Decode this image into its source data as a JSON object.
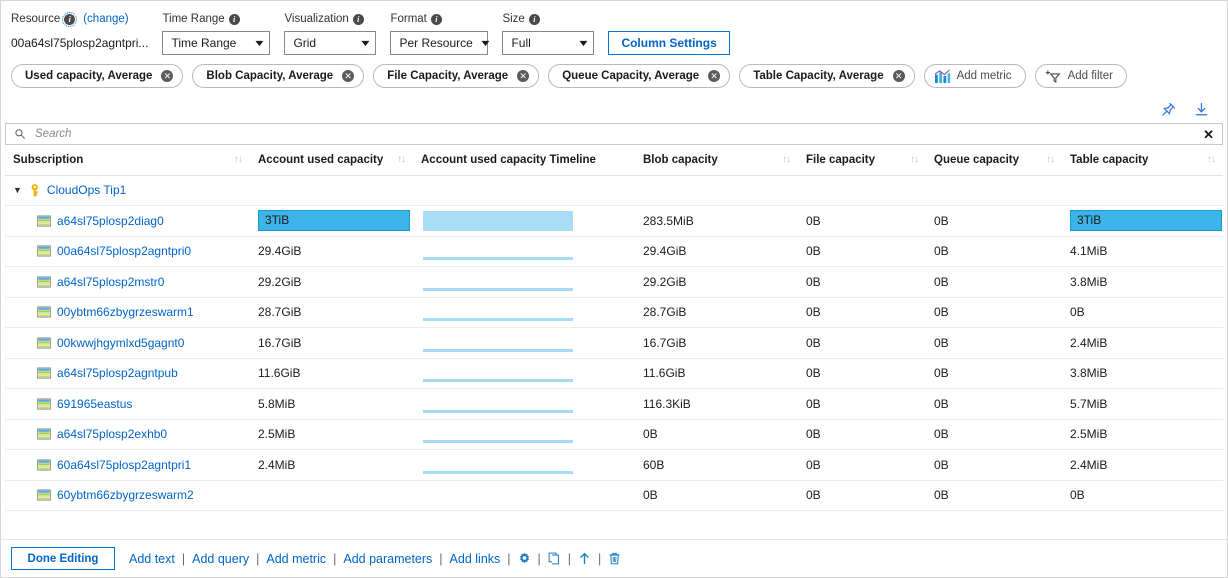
{
  "params": {
    "resource": {
      "label": "Resource",
      "info_icon": "info-icon",
      "change_link": "(change)",
      "value": "00a64sl75plosp2agntpri..."
    },
    "time_range": {
      "label": "Time Range",
      "value": "Time Range"
    },
    "visualization": {
      "label": "Visualization",
      "value": "Grid"
    },
    "format": {
      "label": "Format",
      "value": "Per Resource"
    },
    "size": {
      "label": "Size",
      "value": "Full"
    },
    "column_settings_button": "Column Settings"
  },
  "metric_pills": [
    {
      "label": "Used capacity, Average",
      "remove": "✕"
    },
    {
      "label": "Blob Capacity, Average",
      "remove": "✕"
    },
    {
      "label": "File Capacity, Average",
      "remove": "✕"
    },
    {
      "label": "Queue Capacity, Average",
      "remove": "✕"
    },
    {
      "label": "Table Capacity, Average",
      "remove": "✕"
    }
  ],
  "pill_actions": [
    {
      "label": "Add metric",
      "icon": "bar-chart-icon"
    },
    {
      "label": "Add filter",
      "icon": "funnel-plus-icon"
    }
  ],
  "toolbar_icons": [
    {
      "name": "pin-icon"
    },
    {
      "name": "download-icon"
    }
  ],
  "search": {
    "placeholder": "Search",
    "value": "",
    "icon": "search-icon",
    "clear": "✕"
  },
  "grid": {
    "columns": [
      {
        "label": "Subscription",
        "sortable": true
      },
      {
        "label": "Account used capacity",
        "sortable": true
      },
      {
        "label": "Account used capacity Timeline",
        "sortable": false
      },
      {
        "label": "Blob capacity",
        "sortable": true
      },
      {
        "label": "File capacity",
        "sortable": true
      },
      {
        "label": "Queue capacity",
        "sortable": true
      },
      {
        "label": "Table capacity",
        "sortable": true
      }
    ],
    "sort_glyph": "↑↓",
    "group": {
      "name": "CloudOps Tip1",
      "caret": "▼",
      "icon": "key-icon",
      "expanded": true
    },
    "rows": [
      {
        "name": "a64sl75plosp2diag0",
        "used_capacity": "3TiB",
        "used_capacity_highlighted": true,
        "timeline": "block",
        "blob": "283.5MiB",
        "file": "0B",
        "queue": "0B",
        "table": "3TiB",
        "table_highlighted": true
      },
      {
        "name": "00a64sl75plosp2agntpri0",
        "used_capacity": "29.4GiB",
        "used_capacity_highlighted": false,
        "timeline": "flat",
        "blob": "29.4GiB",
        "file": "0B",
        "queue": "0B",
        "table": "4.1MiB",
        "table_highlighted": false
      },
      {
        "name": "a64sl75plosp2mstr0",
        "used_capacity": "29.2GiB",
        "used_capacity_highlighted": false,
        "timeline": "flat",
        "blob": "29.2GiB",
        "file": "0B",
        "queue": "0B",
        "table": "3.8MiB",
        "table_highlighted": false
      },
      {
        "name": "00ybtm66zbygrzeswarm1",
        "used_capacity": "28.7GiB",
        "used_capacity_highlighted": false,
        "timeline": "flat",
        "blob": "28.7GiB",
        "file": "0B",
        "queue": "0B",
        "table": "0B",
        "table_highlighted": false
      },
      {
        "name": "00kwwjhgymlxd5gagnt0",
        "used_capacity": "16.7GiB",
        "used_capacity_highlighted": false,
        "timeline": "flat",
        "blob": "16.7GiB",
        "file": "0B",
        "queue": "0B",
        "table": "2.4MiB",
        "table_highlighted": false
      },
      {
        "name": "a64sl75plosp2agntpub",
        "used_capacity": "11.6GiB",
        "used_capacity_highlighted": false,
        "timeline": "flat",
        "blob": "11.6GiB",
        "file": "0B",
        "queue": "0B",
        "table": "3.8MiB",
        "table_highlighted": false
      },
      {
        "name": "691965eastus",
        "used_capacity": "5.8MiB",
        "used_capacity_highlighted": false,
        "timeline": "flat",
        "blob": "116.3KiB",
        "file": "0B",
        "queue": "0B",
        "table": "5.7MiB",
        "table_highlighted": false
      },
      {
        "name": "a64sl75plosp2exhb0",
        "used_capacity": "2.5MiB",
        "used_capacity_highlighted": false,
        "timeline": "flat",
        "blob": "0B",
        "file": "0B",
        "queue": "0B",
        "table": "2.5MiB",
        "table_highlighted": false
      },
      {
        "name": "60a64sl75plosp2agntpri1",
        "used_capacity": "2.4MiB",
        "used_capacity_highlighted": false,
        "timeline": "flat",
        "blob": "60B",
        "file": "0B",
        "queue": "0B",
        "table": "2.4MiB",
        "table_highlighted": false
      },
      {
        "name": "60ybtm66zbygrzeswarm2",
        "used_capacity": "",
        "used_capacity_highlighted": false,
        "timeline": "none",
        "blob": "0B",
        "file": "0B",
        "queue": "0B",
        "table": "0B",
        "table_highlighted": false
      }
    ]
  },
  "footer": {
    "done_button": "Done Editing",
    "links": [
      "Add text",
      "Add query",
      "Add metric",
      "Add parameters",
      "Add links"
    ],
    "separator": "|",
    "icons": [
      {
        "name": "gear-icon"
      },
      {
        "name": "copy-icon"
      },
      {
        "name": "move-up-icon"
      },
      {
        "name": "delete-icon"
      }
    ]
  },
  "colors": {
    "accent_blue": "#0064c8",
    "highlight_cell": "#3cb4e8",
    "sparkline": "#a6dcf5",
    "border": "#e2e2e2"
  }
}
